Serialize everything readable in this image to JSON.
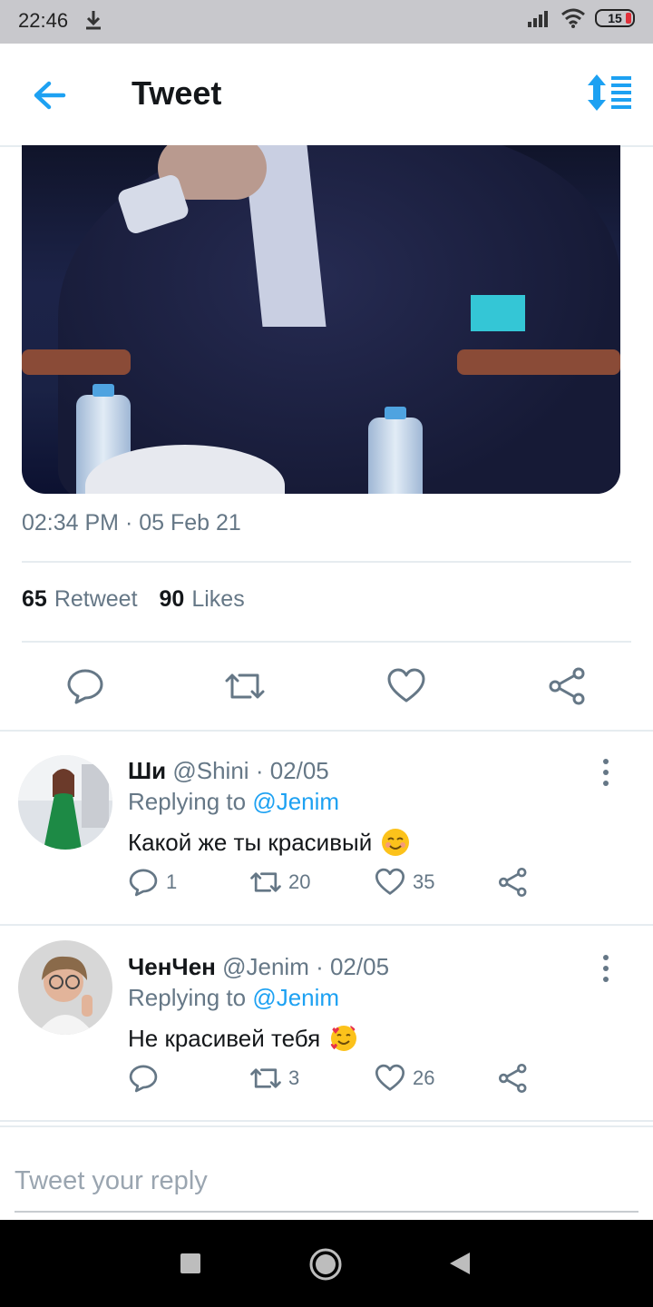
{
  "status": {
    "time": "22:46",
    "battery": "15"
  },
  "header": {
    "title": "Tweet",
    "back_icon": "arrow-left-icon",
    "sort_icon": "sort-icon",
    "accent": "#1da1f2"
  },
  "tweet": {
    "timestamp": "02:34 PM · 05 Feb 21",
    "retweets": "65",
    "retweet_label": "Retweet",
    "likes": "90",
    "likes_label": "Likes"
  },
  "replies": [
    {
      "name": "Ши",
      "handle": "@Shini",
      "date": "· 02/05",
      "replying_prefix": "Replying to",
      "replying_to": "@Jenim",
      "text": "Какой же ты красивый",
      "emoji": "smiling-face-icon",
      "reply_count": "1",
      "retweet_count": "20",
      "like_count": "35"
    },
    {
      "name": "ЧенЧен",
      "handle": "@Jenim",
      "date": "· 02/05",
      "replying_prefix": "Replying to",
      "replying_to": "@Jenim",
      "text": "Не красивей тебя",
      "emoji": "smiling-face-with-hearts-icon",
      "reply_count": "",
      "retweet_count": "3",
      "like_count": "26"
    }
  ],
  "compose": {
    "placeholder": "Tweet your reply"
  }
}
